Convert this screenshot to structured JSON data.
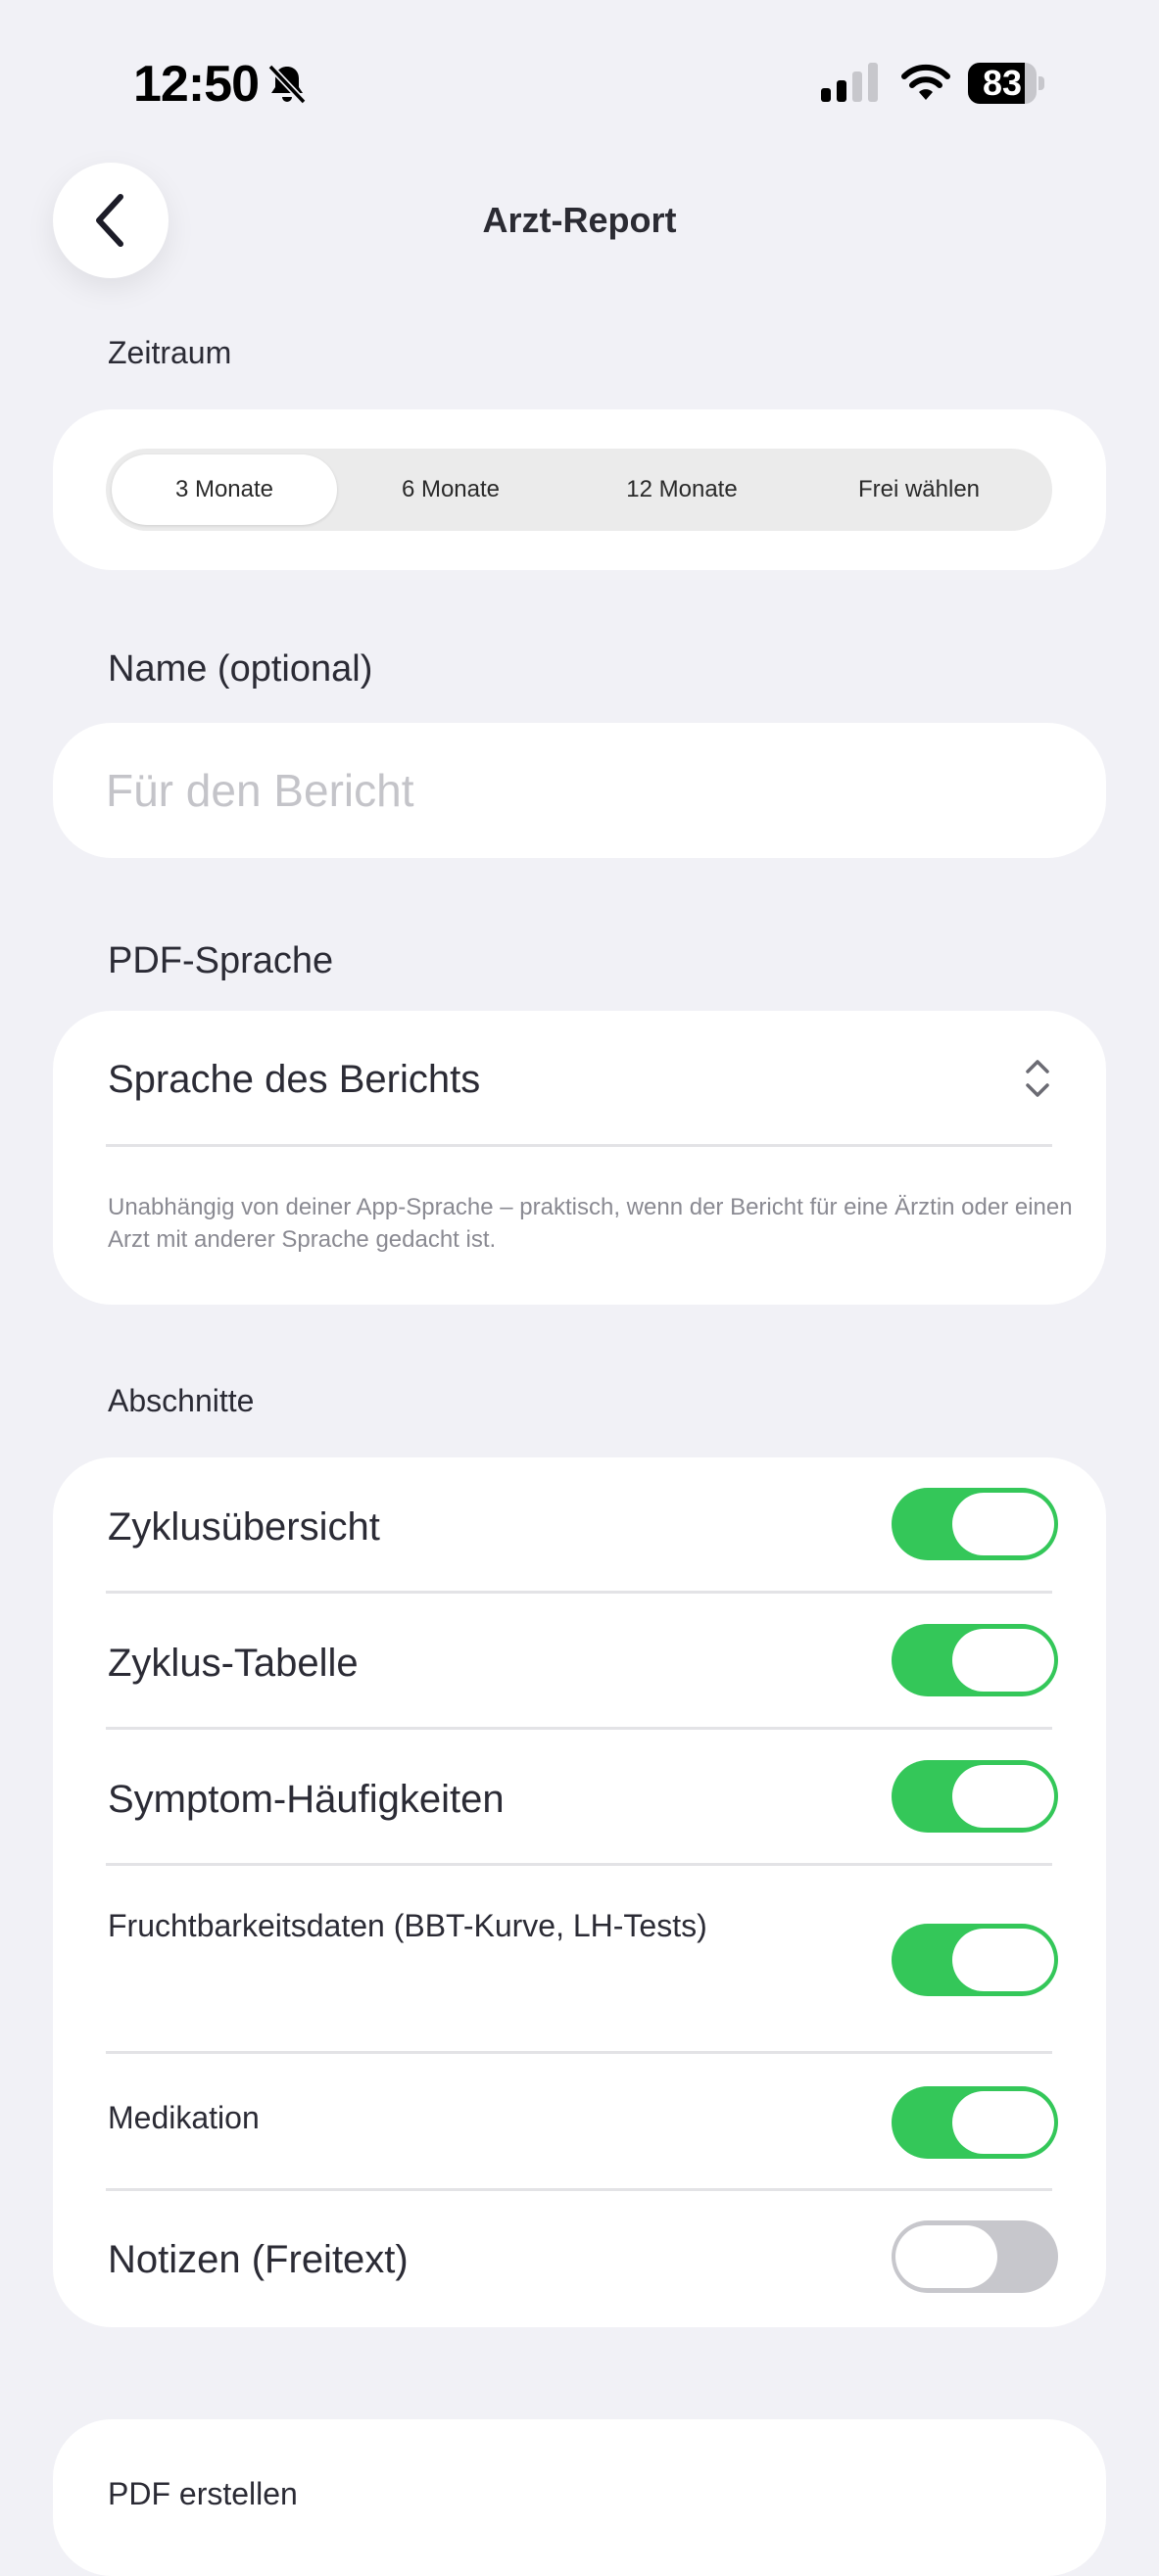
{
  "status_bar": {
    "time": "12:50",
    "battery": "83",
    "battery_level": 0.83
  },
  "nav": {
    "title": "Arzt-Report"
  },
  "zeitraum": {
    "label": "Zeitraum",
    "options": [
      "3 Monate",
      "6 Monate",
      "12 Monate",
      "Frei wählen"
    ],
    "selected": "3 Monate"
  },
  "name": {
    "label": "Name (optional)",
    "placeholder": "Für den Bericht",
    "value": ""
  },
  "pdf_sprache": {
    "label": "PDF-Sprache",
    "picker_label": "Sprache des Berichts",
    "hint": "Unabhängig von deiner App-Sprache – praktisch, wenn der Bericht für eine Ärztin oder einen Arzt mit anderer Sprache gedacht ist."
  },
  "abschnitte": {
    "label": "Abschnitte",
    "items": [
      {
        "label": "Zyklusübersicht",
        "on": true
      },
      {
        "label": "Zyklus-Tabelle",
        "on": true
      },
      {
        "label": "Symptom-Häufigkeiten",
        "on": true
      },
      {
        "label": "Fruchtbarkeitsdaten (BBT-Kurve, LH-Tests)",
        "on": true
      },
      {
        "label": "Medikation",
        "on": true
      },
      {
        "label": "Notizen (Freitext)",
        "on": false
      }
    ]
  },
  "footer": {
    "create_label": "PDF erstellen"
  },
  "colors": {
    "accent_green": "#34c759",
    "background": "#f1f1f6",
    "toggle_off": "#c7c7cc"
  }
}
